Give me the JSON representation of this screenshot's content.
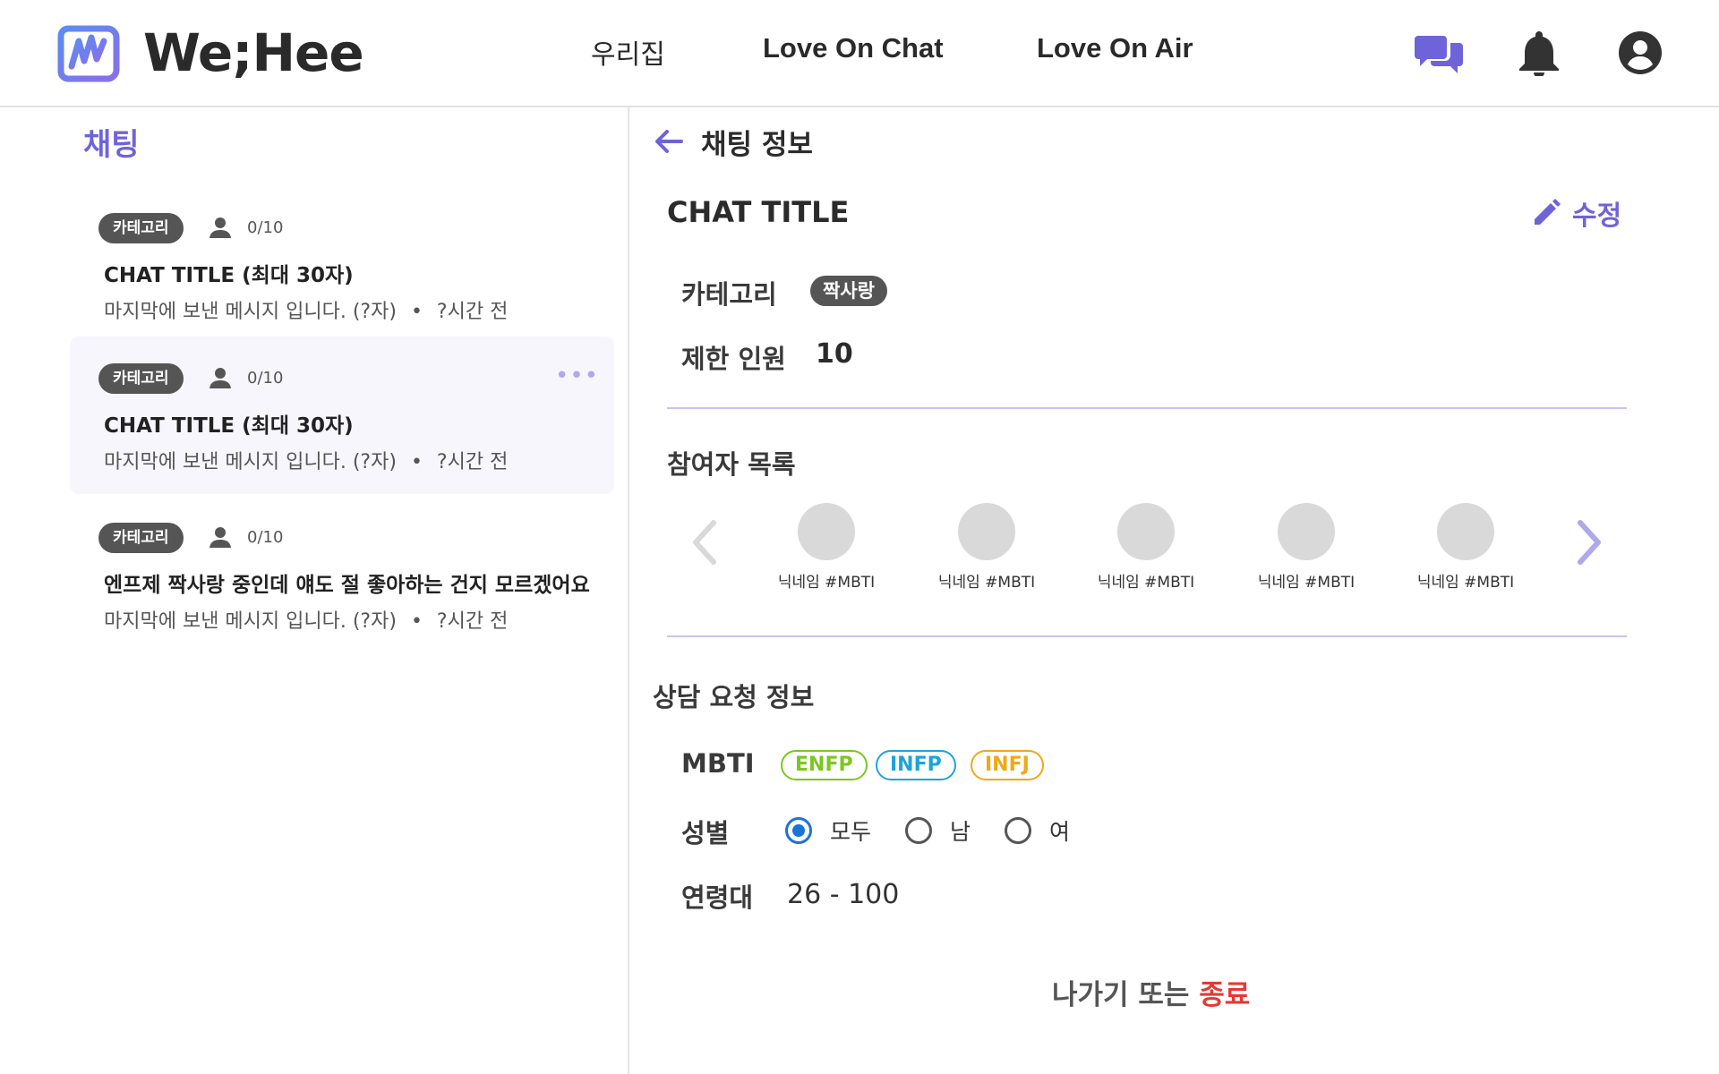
{
  "header": {
    "brand": "We;Hee",
    "nav": [
      {
        "label": "우리집"
      },
      {
        "label": "Love On Chat"
      },
      {
        "label": "Love On Air"
      }
    ],
    "icons": [
      "chat-bubbles-icon",
      "bell-icon",
      "account-icon"
    ],
    "accent_color": "#6f63d9"
  },
  "chat_list": {
    "title": "채팅",
    "items": [
      {
        "category": "카테고리",
        "count": "0/10",
        "title": "CHAT TITLE  (최대 30자)",
        "last_message": "마지막에 보낸 메시지 입니다. (?자)",
        "separator": "•",
        "time": "?시간 전",
        "selected": false
      },
      {
        "category": "카테고리",
        "count": "0/10",
        "title": "CHAT TITLE  (최대 30자)",
        "last_message": "마지막에 보낸 메시지 입니다. (?자)",
        "separator": "•",
        "time": "?시간 전",
        "selected": true,
        "more": "•••"
      },
      {
        "category": "카테고리",
        "count": "0/10",
        "title": "엔프제 짝사랑 중인데 얘도 절 좋아하는 건지 모르겠어요",
        "last_message": "마지막에 보낸 메시지 입니다. (?자)",
        "separator": "•",
        "time": "?시간 전",
        "selected": false
      }
    ]
  },
  "chat_info": {
    "title": "채팅 정보",
    "chat_title": "CHAT TITLE",
    "edit_label": "수정",
    "category_label": "카테고리",
    "category_value": "짝사랑",
    "limit_label": "제한 인원",
    "limit_value": "10",
    "participants_title": "참여자 목록",
    "participants": [
      {
        "nickname": "닉네임 #MBTI"
      },
      {
        "nickname": "닉네임 #MBTI"
      },
      {
        "nickname": "닉네임 #MBTI"
      },
      {
        "nickname": "닉네임 #MBTI"
      },
      {
        "nickname": "닉네임 #MBTI"
      }
    ],
    "request_title": "상담 요청 정보",
    "mbti_label": "MBTI",
    "mbti_tags": [
      {
        "label": "ENFP",
        "color": "#7cc71f"
      },
      {
        "label": "INFP",
        "color": "#1ea3d8"
      },
      {
        "label": "INFJ",
        "color": "#f0a818"
      }
    ],
    "gender_label": "성별",
    "gender_options": [
      {
        "label": "모두",
        "checked": true
      },
      {
        "label": "남",
        "checked": false
      },
      {
        "label": "여",
        "checked": false
      }
    ],
    "age_label": "연령대",
    "age_value": "26 - 100",
    "leave_text": "나가기 또는 ",
    "end_text": "종료",
    "danger_color": "#e53935"
  }
}
